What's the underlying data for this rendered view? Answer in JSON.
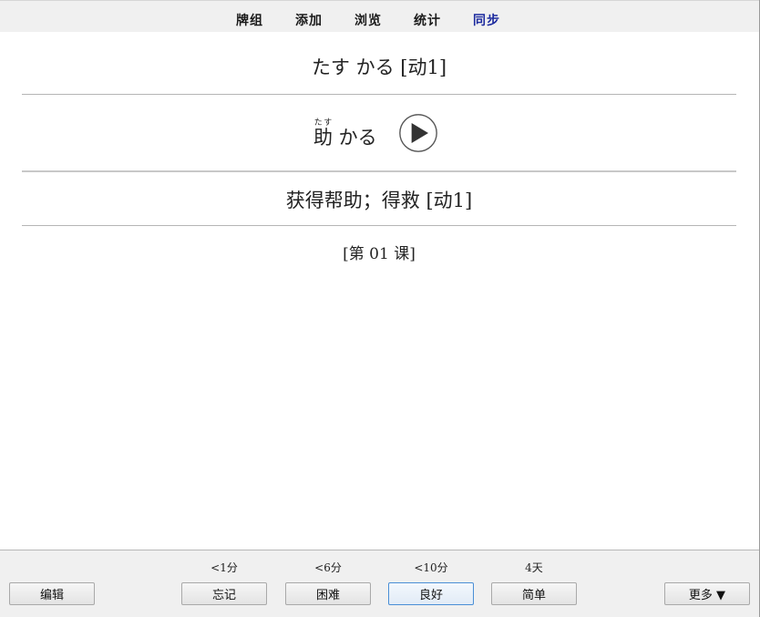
{
  "nav": {
    "decks": "牌组",
    "add": "添加",
    "browse": "浏览",
    "stats": "统计",
    "sync": "同步"
  },
  "card": {
    "front": "たす かる [动1]",
    "word_kanji": "助",
    "word_furigana": "たす",
    "word_okurigana": " かる",
    "meaning": "获得帮助；得救 [动1]",
    "lesson": "[第 01 课]"
  },
  "bottom": {
    "edit": "编辑",
    "again_interval": "<1分",
    "hard_interval": "<6分",
    "good_interval": "<10分",
    "easy_interval": "4天",
    "again": "忘记",
    "hard": "困难",
    "good": "良好",
    "easy": "简单",
    "more": "更多 ▼"
  }
}
